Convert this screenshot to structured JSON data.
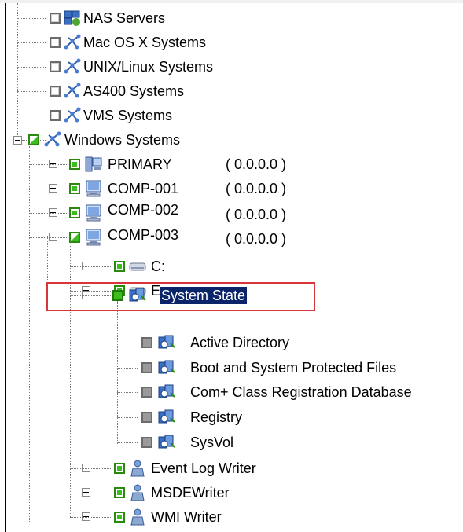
{
  "tree": {
    "nas_servers": "NAS Servers",
    "mac_systems": "Mac OS X Systems",
    "unix_systems": "UNIX/Linux Systems",
    "as400_systems": "AS400 Systems",
    "vms_systems": "VMS Systems",
    "windows_systems": "Windows Systems",
    "primary": {
      "name": "PRIMARY",
      "ip": "( 0.0.0.0 )"
    },
    "comp001": {
      "name": "COMP-001",
      "ip": "( 0.0.0.0 )"
    },
    "comp002": {
      "name": "COMP-002",
      "ip": "( 0.0.0.0 )"
    },
    "comp003": {
      "name": "COMP-003",
      "ip": "( 0.0.0.0 )"
    },
    "drive_c": "C:",
    "drive_e": "E:",
    "system_state": "System State",
    "active_directory": "Active Directory",
    "boot_files": "Boot and System Protected Files",
    "complus": "Com+ Class Registration Database",
    "registry": "Registry",
    "sysvol": "SysVol",
    "event_log_writer": "Event Log Writer",
    "msde_writer": "MSDEWriter",
    "wmi_writer": "WMI Writer"
  }
}
